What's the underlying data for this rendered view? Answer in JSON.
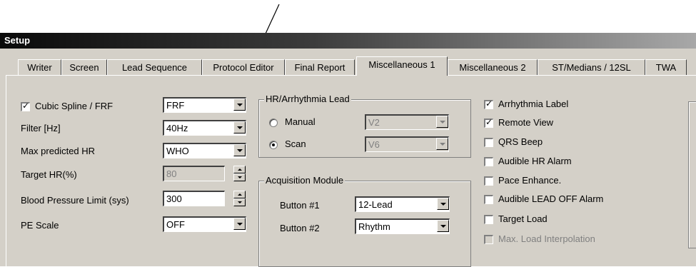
{
  "window": {
    "title": "Setup"
  },
  "tabs": [
    {
      "label": "Writer"
    },
    {
      "label": "Screen"
    },
    {
      "label": "Lead Sequence"
    },
    {
      "label": "Protocol Editor"
    },
    {
      "label": "Final Report"
    },
    {
      "label": "Miscellaneous 1",
      "active": true
    },
    {
      "label": "Miscellaneous 2"
    },
    {
      "label": "ST/Medians / 12SL"
    },
    {
      "label": "TWA"
    }
  ],
  "left": {
    "cubic_spline": {
      "label": "Cubic Spline / FRF",
      "checked": true,
      "value": "FRF"
    },
    "filter": {
      "label": "Filter [Hz]",
      "value": "40Hz"
    },
    "max_hr": {
      "label": "Max predicted HR",
      "value": "WHO"
    },
    "target_hr": {
      "label": "Target HR(%)",
      "value": "80"
    },
    "bp_limit": {
      "label": "Blood Pressure Limit (sys)",
      "value": "300"
    },
    "pe_scale": {
      "label": "PE Scale",
      "value": "OFF"
    }
  },
  "hr_group": {
    "title": "HR/Arrhythmia Lead",
    "manual": {
      "label": "Manual",
      "value": "V2",
      "selected": false
    },
    "scan": {
      "label": "Scan",
      "value": "V6",
      "selected": true
    }
  },
  "acq_group": {
    "title": "Acquisition Module",
    "button1": {
      "label": "Button #1",
      "value": "12-Lead"
    },
    "button2": {
      "label": "Button #2",
      "value": "Rhythm"
    }
  },
  "right_checks": [
    {
      "label": "Arrhythmia Label",
      "checked": true,
      "disabled": false
    },
    {
      "label": "Remote View",
      "checked": true,
      "disabled": false
    },
    {
      "label": "QRS Beep",
      "checked": false,
      "disabled": false
    },
    {
      "label": "Audible HR Alarm",
      "checked": false,
      "disabled": false
    },
    {
      "label": "Pace Enhance.",
      "checked": false,
      "disabled": false
    },
    {
      "label": "Audible LEAD OFF Alarm",
      "checked": false,
      "disabled": false
    },
    {
      "label": "Target Load",
      "checked": false,
      "disabled": false
    },
    {
      "label": "Max. Load Interpolation",
      "checked": false,
      "disabled": true
    }
  ]
}
